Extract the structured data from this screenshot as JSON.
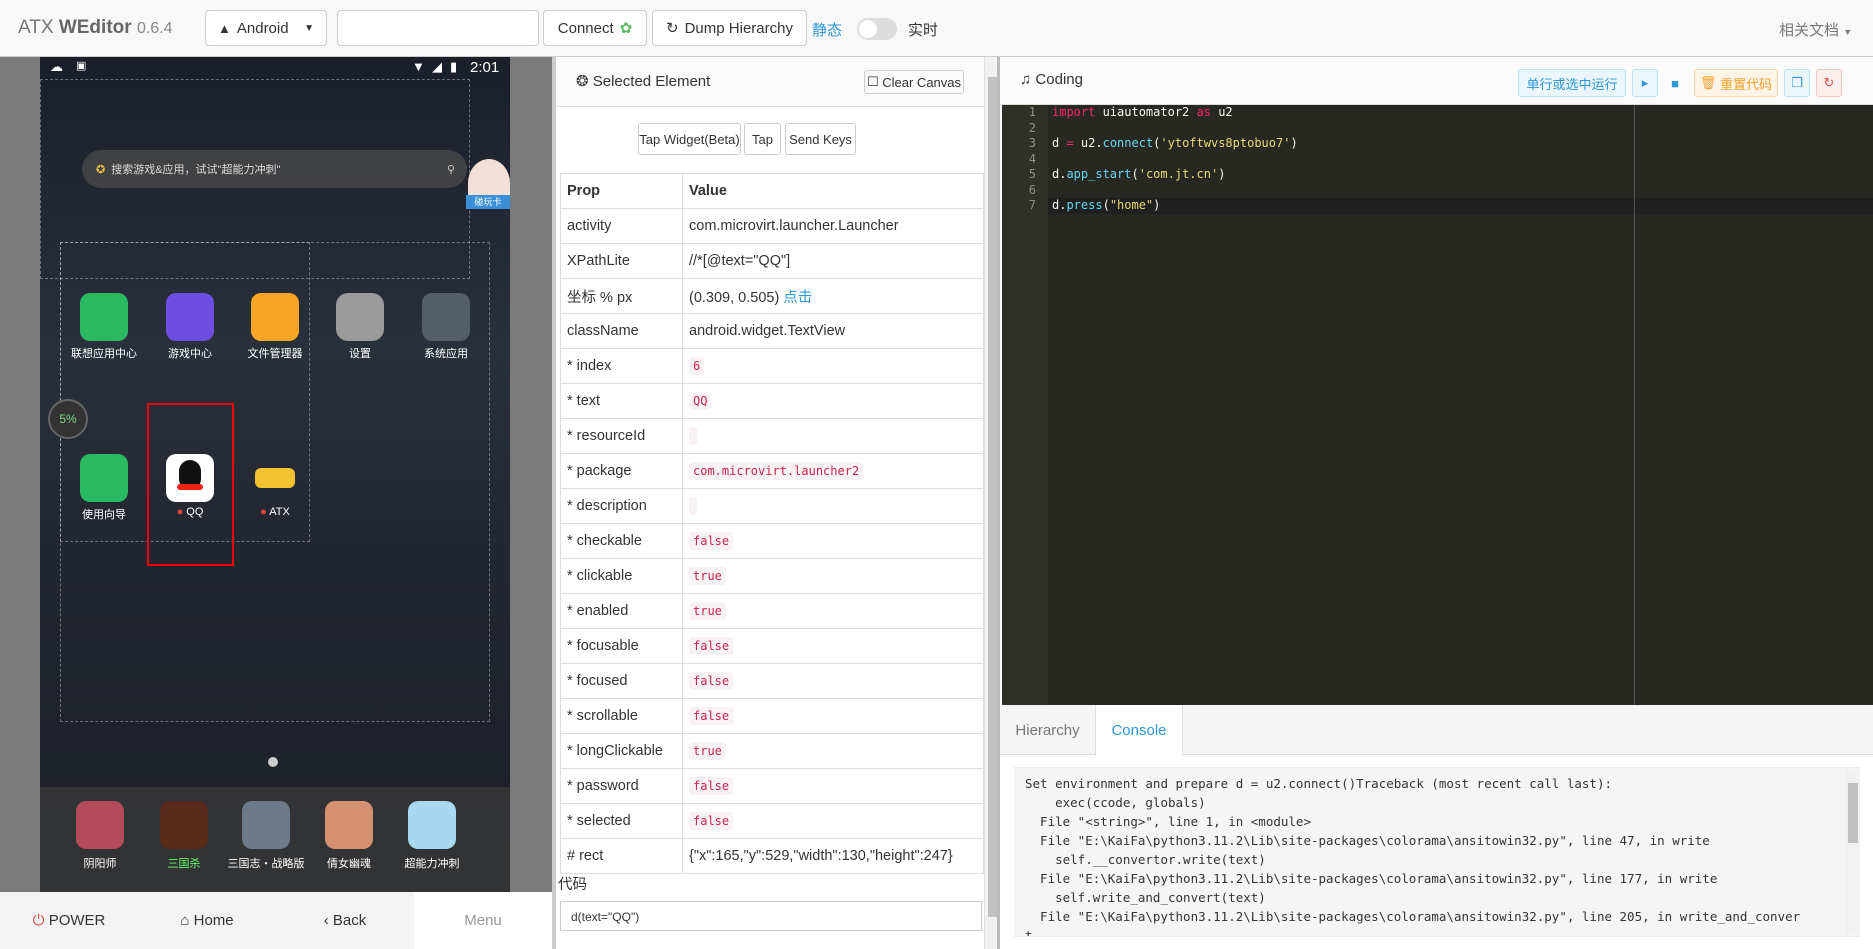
{
  "topbar": {
    "brand_prefix": "ATX ",
    "brand_name": "WEditor",
    "version": "0.6.4",
    "platform": "Android",
    "address_value": "",
    "connect": "Connect",
    "dump": "Dump Hierarchy",
    "mode_static": "静态",
    "mode_realtime": "实时",
    "docs": "相关文档"
  },
  "phone": {
    "time": "2:01",
    "search_placeholder": "搜索游戏&应用，试试\"超能力冲刺\"",
    "mascot_label": "碰玩卡",
    "battery": "5%",
    "apps_row1": [
      "联想应用中心",
      "游戏中心",
      "文件管理器",
      "设置",
      "系统应用"
    ],
    "apps_row2": [
      "使用向导",
      "QQ",
      "ATX"
    ],
    "dock": [
      "阴阳师",
      "三国杀",
      "三国志・战略版",
      "倩女幽魂",
      "超能力冲刺"
    ]
  },
  "navbar": {
    "power": "POWER",
    "home": "Home",
    "back": "Back",
    "menu": "Menu"
  },
  "selected": {
    "title": "Selected Element",
    "clear_canvas": "Clear Canvas",
    "tap_widget": "Tap Widget(Beta)",
    "tap": "Tap",
    "send_keys": "Send Keys",
    "prop_header": "Prop",
    "value_header": "Value",
    "rows": [
      {
        "k": "activity",
        "v": "com.microvirt.launcher.Launcher",
        "code": false
      },
      {
        "k": "XPathLite",
        "v": "//*[@text=\"QQ\"]",
        "code": false
      },
      {
        "k": "坐标 % px",
        "v": "(0.309, 0.505)",
        "extra": "点击",
        "code": false
      },
      {
        "k": "className",
        "v": "android.widget.TextView",
        "code": false
      },
      {
        "k": "* index",
        "v": "6",
        "code": true
      },
      {
        "k": "* text",
        "v": "QQ",
        "code": true
      },
      {
        "k": "* resourceId",
        "v": "",
        "code": true
      },
      {
        "k": "* package",
        "v": "com.microvirt.launcher2",
        "code": true
      },
      {
        "k": "* description",
        "v": "",
        "code": true
      },
      {
        "k": "* checkable",
        "v": "false",
        "code": true
      },
      {
        "k": "* clickable",
        "v": "true",
        "code": true
      },
      {
        "k": "* enabled",
        "v": "true",
        "code": true
      },
      {
        "k": "* focusable",
        "v": "false",
        "code": true
      },
      {
        "k": "* focused",
        "v": "false",
        "code": true
      },
      {
        "k": "* scrollable",
        "v": "false",
        "code": true
      },
      {
        "k": "* longClickable",
        "v": "true",
        "code": true
      },
      {
        "k": "* password",
        "v": "false",
        "code": true
      },
      {
        "k": "* selected",
        "v": "false",
        "code": true
      },
      {
        "k": "# rect",
        "v": "{\"x\":165,\"y\":529,\"width\":130,\"height\":247}",
        "code": false
      }
    ],
    "code_label": "代码",
    "code_value": "d(text=\"QQ\")"
  },
  "coding": {
    "title": "Coding",
    "run_selected": "单行或选中运行",
    "reset_code": "重置代码",
    "line_numbers": [
      "1",
      "2",
      "3",
      "4",
      "5",
      "6",
      "7"
    ],
    "code_lines": [
      "import uiautomator2 as u2",
      "",
      "d = u2.connect('ytoftwvs8ptobuo7')",
      "",
      "d.app_start('com.jt.cn')",
      "",
      "d.press(\"home\")"
    ]
  },
  "bottom_tabs": {
    "hierarchy": "Hierarchy",
    "console": "Console"
  },
  "console_text": "Set environment and prepare d = u2.connect()Traceback (most recent call last):\n    exec(ccode, globals)\n  File \"<string>\", line 1, in <module>\n  File \"E:\\KaiFa\\python3.11.2\\Lib\\site-packages\\colorama\\ansitowin32.py\", line 47, in write\n    self.__convertor.write(text)\n  File \"E:\\KaiFa\\python3.11.2\\Lib\\site-packages\\colorama\\ansitowin32.py\", line 177, in write\n    self.write_and_convert(text)\n  File \"E:\\KaiFa\\python3.11.2\\Lib\\site-packages\\colorama\\ansitowin32.py\", line 205, in write_and_conver\nt",
  "colors": {
    "accent": "#2e97d8",
    "selection": "#ee0000",
    "editor_bg": "#272822"
  }
}
